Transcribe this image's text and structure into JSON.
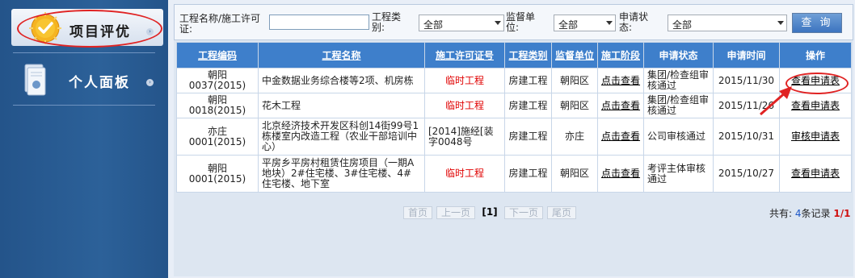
{
  "sidebar": {
    "items": [
      {
        "label": "项目评优",
        "icon": "medal-check-icon"
      },
      {
        "label": "个人面板",
        "icon": "document-icon"
      }
    ]
  },
  "search": {
    "project_label": "工程名称/施工许可证:",
    "project_value": "",
    "category_label": "工程类别:",
    "category_value": "全部",
    "supervisor_label": "监督单位:",
    "supervisor_value": "全部",
    "status_label": "申请状态:",
    "status_value": "全部",
    "button_label": "查 询"
  },
  "table": {
    "headers": [
      "工程编码",
      "工程名称",
      "施工许可证号",
      "工程类别",
      "监督单位",
      "施工阶段",
      "申请状态",
      "申请时间",
      "操作"
    ],
    "rows": [
      {
        "code": "朝阳0037(2015)",
        "name": "中金数据业务综合楼等2项、机房栋",
        "permit": "临时工程",
        "category": "房建工程",
        "unit": "朝阳区",
        "stage": "点击查看",
        "status": "集团/检查组审核通过",
        "date": "2015/11/30",
        "action": "查看申请表"
      },
      {
        "code": "朝阳0018(2015)",
        "name": "花木工程",
        "permit": "临时工程",
        "category": "房建工程",
        "unit": "朝阳区",
        "stage": "点击查看",
        "status": "集团/检查组审核通过",
        "date": "2015/11/26",
        "action": "查看申请表"
      },
      {
        "code": "亦庄0001(2015)",
        "name": "北京经济技术开发区科创14街99号1栋楼室内改造工程（农业干部培训中心）",
        "permit": "[2014]施经[装字0048号",
        "category": "房建工程",
        "unit": "亦庄",
        "stage": "点击查看",
        "status": "公司审核通过",
        "date": "2015/10/31",
        "action": "审核申请表"
      },
      {
        "code": "朝阳0001(2015)",
        "name": "平房乡平房村租赁住房项目（一期A地块）2#住宅楼、3#住宅楼、4#住宅楼、地下室",
        "permit": "临时工程",
        "category": "房建工程",
        "unit": "朝阳区",
        "stage": "点击查看",
        "status": "考评主体审核通过",
        "date": "2015/10/27",
        "action": "查看申请表"
      }
    ]
  },
  "pager": {
    "first": "首页",
    "prev": "上一页",
    "current": "[1]",
    "next": "下一页",
    "last": "尾页",
    "total_prefix": "共有:",
    "total_count": "4",
    "total_suffix": "条记录",
    "pages": "1/1"
  },
  "colors": {
    "accent": "#3e7fcb",
    "sidebar": "#2c6199",
    "highlight": "#e02323"
  }
}
